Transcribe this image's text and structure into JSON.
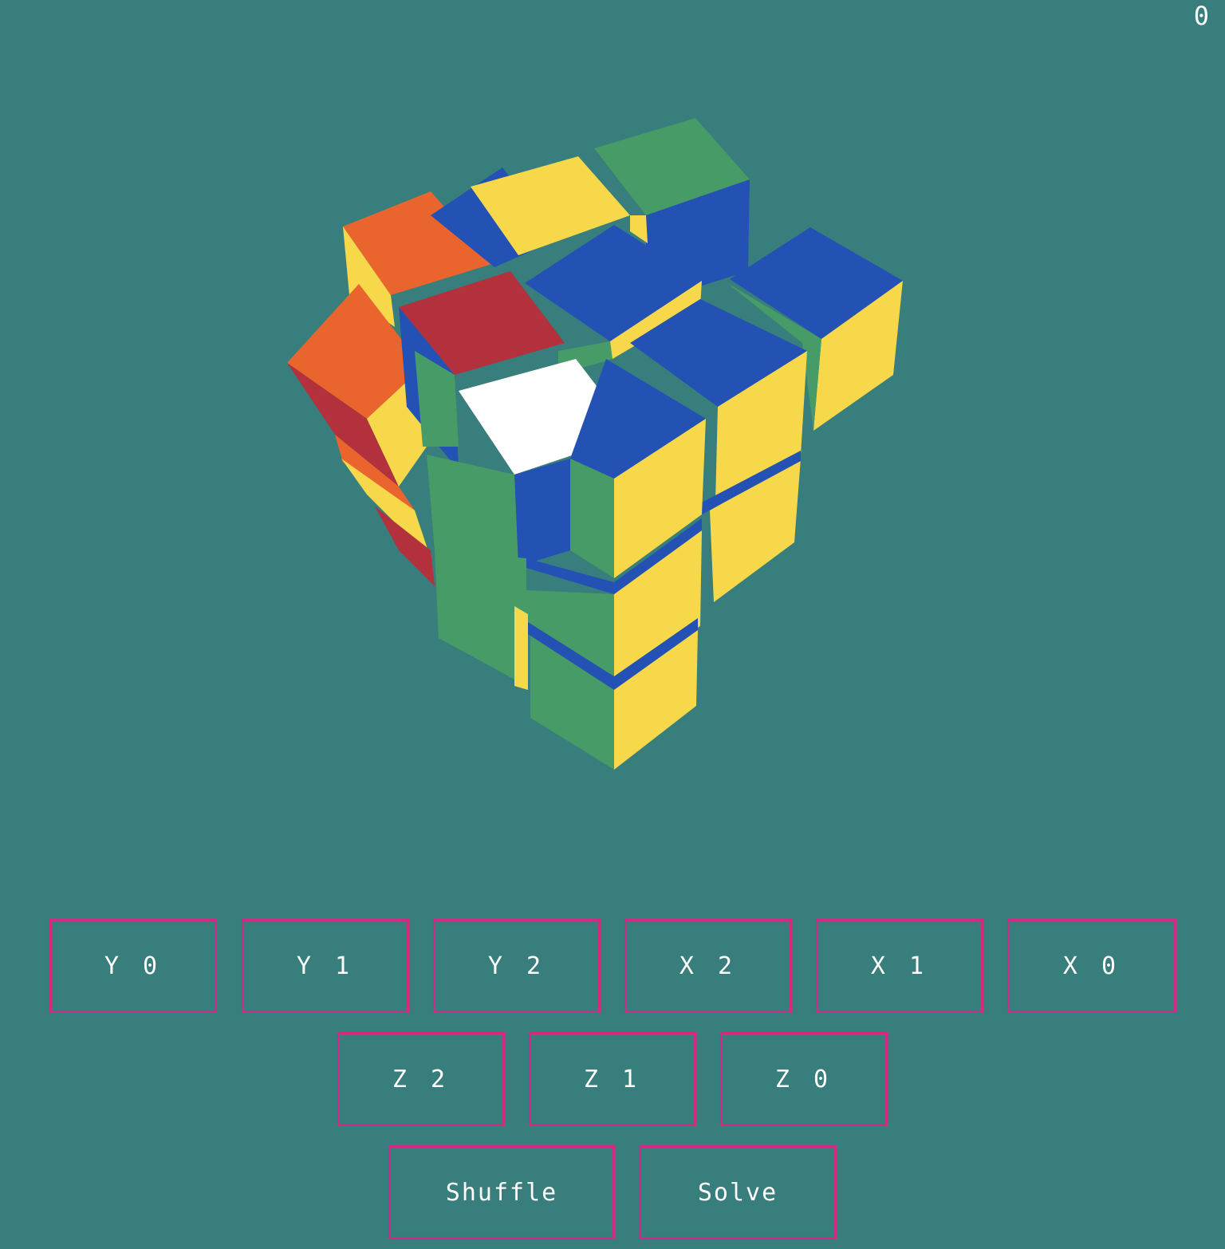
{
  "counter": {
    "moves": "0"
  },
  "colors": {
    "background": "#387e7c",
    "button_border": "#d42a86",
    "sticker_green": "#479b67",
    "sticker_blue": "#2351b4",
    "sticker_yellow": "#f7d84b",
    "sticker_orange": "#ea652d",
    "sticker_red": "#b2313d",
    "sticker_white": "#ffffff"
  },
  "controls": {
    "row1": [
      {
        "id": "y0",
        "label": "Y 0"
      },
      {
        "id": "y1",
        "label": "Y 1"
      },
      {
        "id": "y2",
        "label": "Y 2"
      },
      {
        "id": "x2",
        "label": "X 2"
      },
      {
        "id": "x1",
        "label": "X 1"
      },
      {
        "id": "x0",
        "label": "X 0"
      }
    ],
    "row2": [
      {
        "id": "z2",
        "label": "Z 2"
      },
      {
        "id": "z1",
        "label": "Z 1"
      },
      {
        "id": "z0",
        "label": "Z 0"
      }
    ],
    "row3": [
      {
        "id": "shuffle",
        "label": "Shuffle"
      },
      {
        "id": "solve",
        "label": "Solve"
      }
    ]
  }
}
